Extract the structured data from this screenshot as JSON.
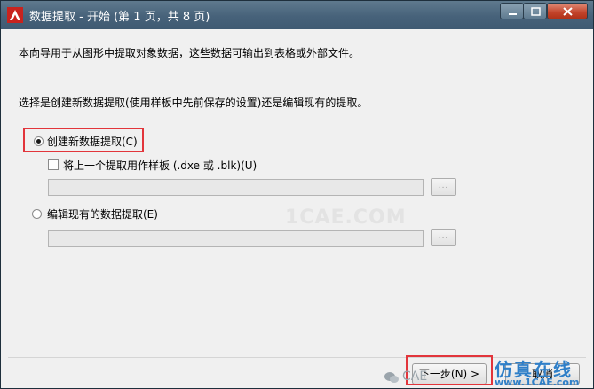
{
  "window": {
    "title": "数据提取 - 开始 (第 1 页，共 8 页)"
  },
  "intro": {
    "line1": "本向导用于从图形中提取对象数据，这些数据可输出到表格或外部文件。",
    "line2": "选择是创建新数据提取(使用样板中先前保存的设置)还是编辑现有的提取。"
  },
  "options": {
    "create_new": {
      "label": "创建新数据提取(C)",
      "selected": true
    },
    "use_template": {
      "label": "将上一个提取用作样板 (.dxe 或 .blk)(U)",
      "checked": false,
      "value": ""
    },
    "edit_existing": {
      "label": "编辑现有的数据提取(E)",
      "selected": false,
      "value": ""
    },
    "browse_label": "..."
  },
  "buttons": {
    "next": "下一步(N) >",
    "cancel": "取消"
  },
  "overlay": {
    "watermark": "1CAE.COM",
    "brand": "仿真在线",
    "brand_url": "www.1CAE.com",
    "wechat_label": "CAE"
  },
  "colors": {
    "highlight": "#e2353b",
    "titlebar": "#47627a",
    "close": "#c2432a"
  }
}
